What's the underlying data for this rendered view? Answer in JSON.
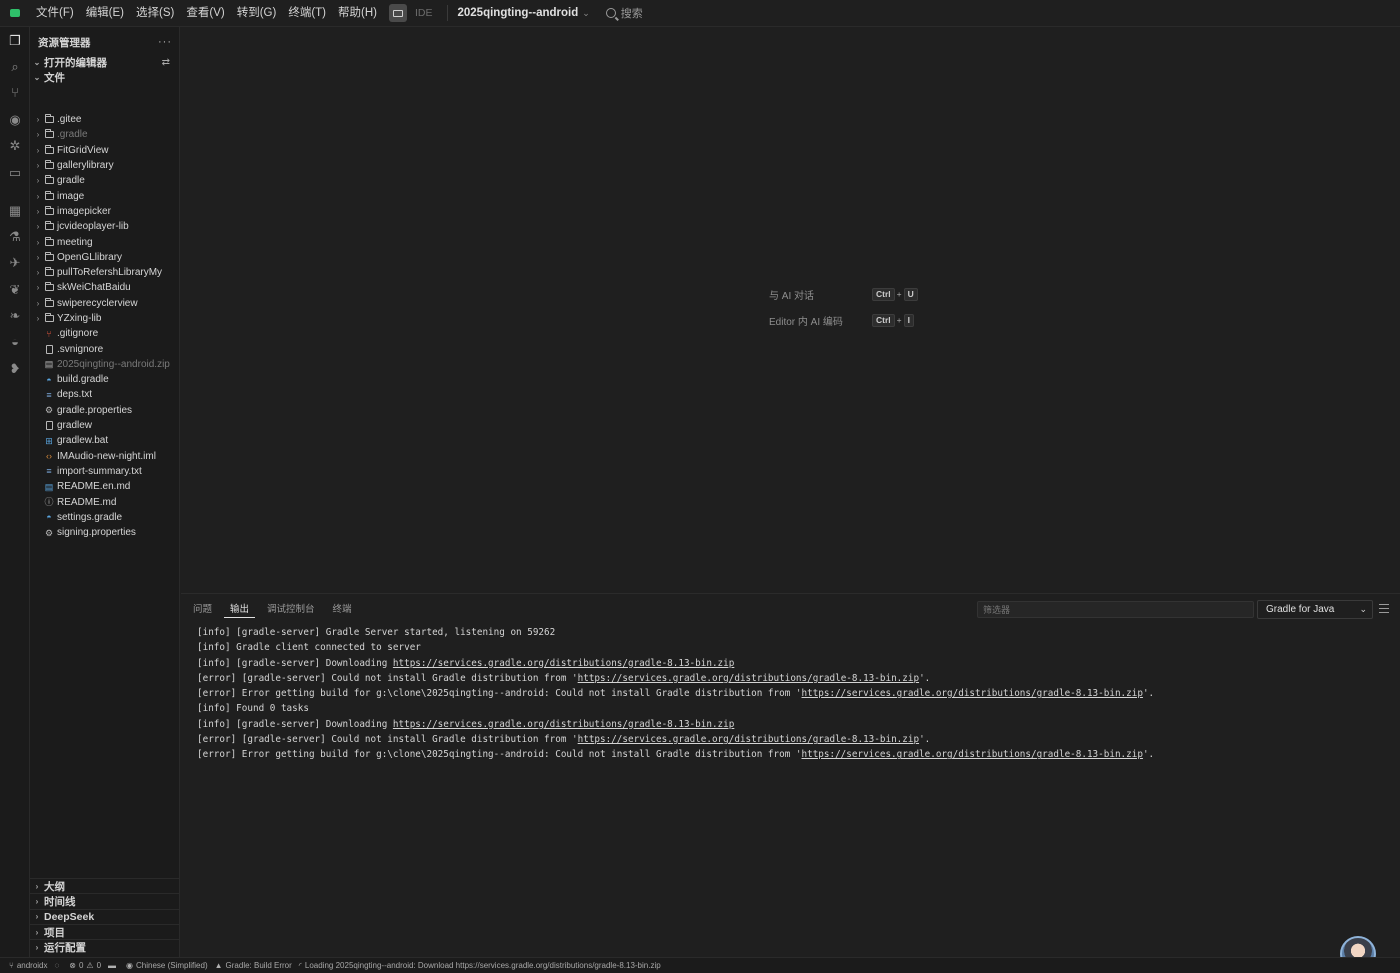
{
  "menubar": {
    "items": [
      "文件(F)",
      "编辑(E)",
      "选择(S)",
      "查看(V)",
      "转到(G)",
      "终端(T)",
      "帮助(H)"
    ],
    "ide_label": "IDE",
    "project": "2025qingting--android",
    "search": "搜索"
  },
  "activity_icons": [
    "explorer-icon",
    "search-icon",
    "source-control-icon",
    "eye-icon",
    "debug-icon",
    "remote-icon",
    "extensions-icon",
    "testing-icon",
    "plugin-icon",
    "bird-icon",
    "bird2-icon",
    "gradle-icon",
    "chat-icon"
  ],
  "sidebar": {
    "title": "资源管理器",
    "more": "···",
    "open_editors": "打开的编辑器",
    "files_section": "文件",
    "items": [
      {
        "name": ".gitee",
        "type": "folder"
      },
      {
        "name": ".gradle",
        "type": "folder",
        "dim": true
      },
      {
        "name": "FitGridView",
        "type": "folder"
      },
      {
        "name": "gallerylibrary",
        "type": "folder"
      },
      {
        "name": "gradle",
        "type": "folder"
      },
      {
        "name": "image",
        "type": "folder"
      },
      {
        "name": "imagepicker",
        "type": "folder"
      },
      {
        "name": "jcvideoplayer-lib",
        "type": "folder"
      },
      {
        "name": "meeting",
        "type": "folder"
      },
      {
        "name": "OpenGLlibrary",
        "type": "folder"
      },
      {
        "name": "pullToRefershLibraryMy",
        "type": "folder"
      },
      {
        "name": "skWeiChatBaidu",
        "type": "folder"
      },
      {
        "name": "swiperecyclerview",
        "type": "folder"
      },
      {
        "name": "YZxing-lib",
        "type": "folder"
      },
      {
        "name": ".gitignore",
        "type": "file",
        "icon": "git-icon",
        "color": "#e2553d"
      },
      {
        "name": ".svnignore",
        "type": "file",
        "icon": "file-icon"
      },
      {
        "name": "2025qingting--android.zip",
        "type": "file",
        "icon": "zip-icon",
        "dim": true
      },
      {
        "name": "build.gradle",
        "type": "file",
        "icon": "gradle-icon",
        "color": "#5aa6e0"
      },
      {
        "name": "deps.txt",
        "type": "file",
        "icon": "text-icon",
        "color": "#7aa7d8"
      },
      {
        "name": "gradle.properties",
        "type": "file",
        "icon": "gear-icon"
      },
      {
        "name": "gradlew",
        "type": "file",
        "icon": "file-icon"
      },
      {
        "name": "gradlew.bat",
        "type": "file",
        "icon": "windows-icon",
        "color": "#5aa6e0"
      },
      {
        "name": "IMAudio-new-night.iml",
        "type": "file",
        "icon": "code-icon",
        "color": "#d58a3c"
      },
      {
        "name": "import-summary.txt",
        "type": "file",
        "icon": "text-icon",
        "color": "#7aa7d8"
      },
      {
        "name": "README.en.md",
        "type": "file",
        "icon": "markdown-icon",
        "color": "#5aa6e0"
      },
      {
        "name": "README.md",
        "type": "file",
        "icon": "info-icon"
      },
      {
        "name": "settings.gradle",
        "type": "file",
        "icon": "gradle-icon",
        "color": "#5aa6e0"
      },
      {
        "name": "signing.properties",
        "type": "file",
        "icon": "gear-icon"
      }
    ],
    "bottom_sections": [
      "大纲",
      "时间线",
      "DeepSeek",
      "项目",
      "运行配置"
    ]
  },
  "editor": {
    "hints": [
      {
        "label": "与 AI 对话",
        "key1": "Ctrl",
        "plus": "+",
        "key2": "U"
      },
      {
        "label": "Editor 内 AI 编码",
        "key1": "Ctrl",
        "plus": "+",
        "key2": "I"
      }
    ]
  },
  "panel": {
    "tabs": [
      "问题",
      "输出",
      "调试控制台",
      "终端"
    ],
    "active_tab": "输出",
    "filter_placeholder": "筛选器",
    "channel": "Gradle for Java",
    "lines": [
      {
        "pre": "[info] [gradle-server] Gradle Server started, listening on 59262",
        "link": "",
        "post": ""
      },
      {
        "pre": "[info] Gradle client connected to server",
        "link": "",
        "post": ""
      },
      {
        "pre": "[info] [gradle-server] Downloading ",
        "link": "https://services.gradle.org/distributions/gradle-8.13-bin.zip",
        "post": ""
      },
      {
        "pre": "[error] [gradle-server] Could not install Gradle distribution from '",
        "link": "https://services.gradle.org/distributions/gradle-8.13-bin.zip",
        "post": "'."
      },
      {
        "pre": "[error] Error getting build for g:\\clone\\2025qingting--android: Could not install Gradle distribution from '",
        "link": "https://services.gradle.org/distributions/gradle-8.13-bin.zip",
        "post": "'."
      },
      {
        "pre": "[info] Found 0 tasks",
        "link": "",
        "post": ""
      },
      {
        "pre": "[info] [gradle-server] Downloading ",
        "link": "https://services.gradle.org/distributions/gradle-8.13-bin.zip",
        "post": ""
      },
      {
        "pre": "[error] [gradle-server] Could not install Gradle distribution from '",
        "link": "https://services.gradle.org/distributions/gradle-8.13-bin.zip",
        "post": "'."
      },
      {
        "pre": "[error] Error getting build for g:\\clone\\2025qingting--android: Could not install Gradle distribution from '",
        "link": "https://services.gradle.org/distributions/gradle-8.13-bin.zip",
        "post": "'."
      }
    ]
  },
  "statusbar": {
    "branch": "androidx",
    "errors": "0",
    "warnings": "0",
    "language": "Chinese (Simplified)",
    "gradle": "Gradle: Build Error",
    "loading": "Loading 2025qingting--android: Download https://services.gradle.org/distributions/gradle-8.13-bin.zip"
  }
}
